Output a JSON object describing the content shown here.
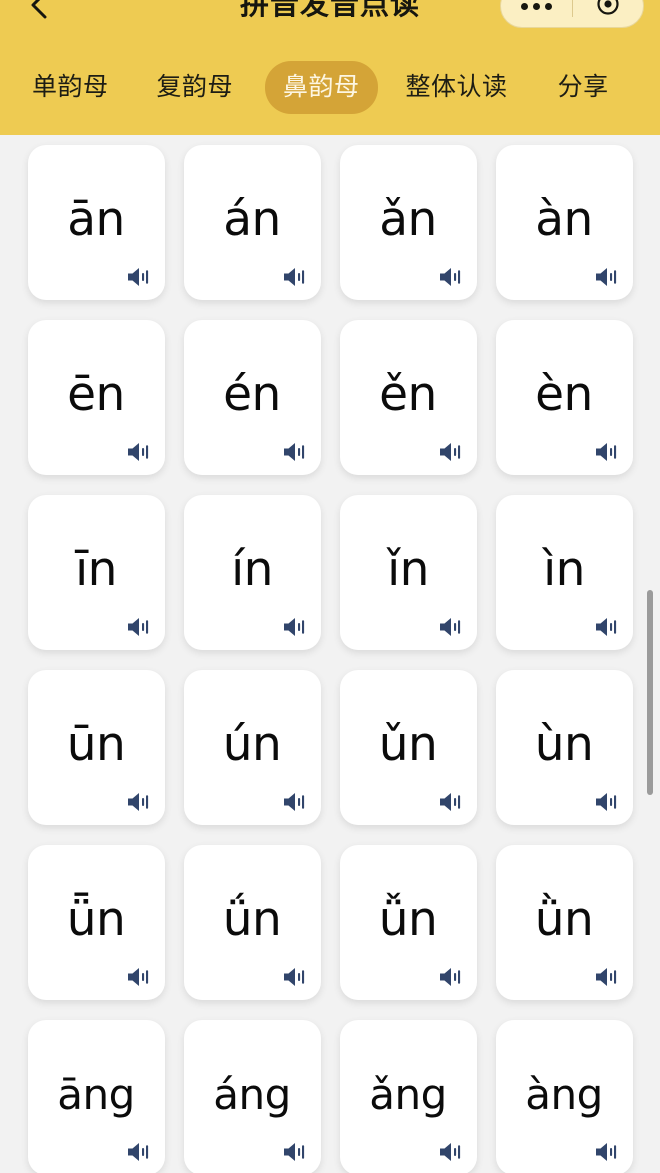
{
  "header": {
    "title": "拼音发音点读",
    "background_color": "#eecb52",
    "back_icon": "back-chevron-icon",
    "capsule": {
      "menu_icon": "more-dots-icon",
      "close_icon": "target-circle-icon"
    }
  },
  "tabs": {
    "active_index": 2,
    "active_color": "#d4a437",
    "items": [
      {
        "label": "单韵母",
        "active": false
      },
      {
        "label": "复韵母",
        "active": false
      },
      {
        "label": "鼻韵母",
        "active": true
      },
      {
        "label": "整体认读",
        "active": false
      },
      {
        "label": "分享",
        "active": false
      }
    ]
  },
  "grid": {
    "columns": 4,
    "speaker_icon": "speaker-volume-icon",
    "speaker_color": "#31456b",
    "card_background": "#ffffff",
    "page_background": "#f2f2f2",
    "cards": [
      {
        "pinyin": "ān"
      },
      {
        "pinyin": "án"
      },
      {
        "pinyin": "ǎn"
      },
      {
        "pinyin": "àn"
      },
      {
        "pinyin": "ēn"
      },
      {
        "pinyin": "én"
      },
      {
        "pinyin": "ěn"
      },
      {
        "pinyin": "èn"
      },
      {
        "pinyin": "īn"
      },
      {
        "pinyin": "ín"
      },
      {
        "pinyin": "ǐn"
      },
      {
        "pinyin": "ìn"
      },
      {
        "pinyin": "ūn"
      },
      {
        "pinyin": "ún"
      },
      {
        "pinyin": "ǔn"
      },
      {
        "pinyin": "ùn"
      },
      {
        "pinyin": "ǖn"
      },
      {
        "pinyin": "ǘn"
      },
      {
        "pinyin": "ǚn"
      },
      {
        "pinyin": "ǜn"
      },
      {
        "pinyin": "āng"
      },
      {
        "pinyin": "áng"
      },
      {
        "pinyin": "ǎng"
      },
      {
        "pinyin": "àng"
      }
    ]
  },
  "scrollbar": {
    "visible": true,
    "thumb_color": "#9b9b9b"
  }
}
